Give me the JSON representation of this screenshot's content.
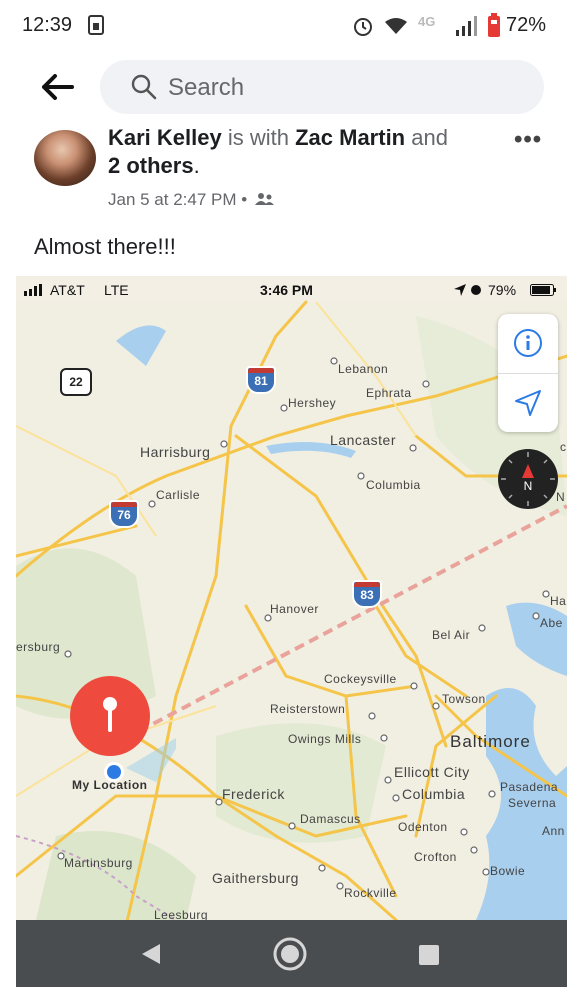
{
  "status_bar": {
    "time": "12:39",
    "battery": "72%",
    "network": "4G"
  },
  "header": {
    "search_placeholder": "Search"
  },
  "post": {
    "author": "Kari Kelley",
    "with_text": " is with ",
    "tagged": "Zac Martin",
    "and_text": " and",
    "others": "2 others",
    "period": ".",
    "meta": "Jan 5 at 2:47 PM •",
    "text": "Almost there!!!",
    "more": "•••"
  },
  "map_screenshot": {
    "carrier": "AT&T",
    "network": "LTE",
    "time": "3:46 PM",
    "battery": "79%",
    "places": {
      "lebanon": "Lebanon",
      "hershey": "Hershey",
      "ephrata": "Ephrata",
      "lancaster": "Lancaster",
      "harrisburg": "Harrisburg",
      "carlisle": "Carlisle",
      "columbia_pa": "Columbia",
      "hanover": "Hanover",
      "bel_air": "Bel Air",
      "ha": "Ha",
      "abe": "Abe",
      "ersburg": "ersburg",
      "cockeysville": "Cockeysville",
      "towson": "Towson",
      "reisterstown": "Reisterstown",
      "owings_mills": "Owings Mills",
      "baltimore": "Baltimore",
      "my_location": "My Location",
      "frederick": "Frederick",
      "ellicott_city": "Ellicott City",
      "columbia_md": "Columbia",
      "pasadena": "Pasadena",
      "severna": "Severna",
      "damascus": "Damascus",
      "odenton": "Odenton",
      "ann": "Ann",
      "crofton": "Crofton",
      "martinsburg": "Martinsburg",
      "gaithersburg": "Gaithersburg",
      "bowie": "Bowie",
      "rockville": "Rockville",
      "leesburg": "Leesburg",
      "c": "c",
      "n": "N"
    },
    "highways": {
      "i81": "81",
      "i76": "76",
      "i83": "83",
      "us22": "22"
    },
    "compass_label": "N"
  },
  "colors": {
    "map_bg": "#f3efe4",
    "road": "#f5c54a",
    "water": "#a9cfee",
    "pin": "#ee4b3e",
    "navbar": "#4a4d4f",
    "link_blue": "#2c7be5"
  },
  "icons": {
    "back": "arrow-left-icon",
    "search": "search-icon",
    "friends": "friends-icon",
    "info": "info-icon",
    "locate": "location-arrow-icon",
    "compass": "compass-icon"
  }
}
